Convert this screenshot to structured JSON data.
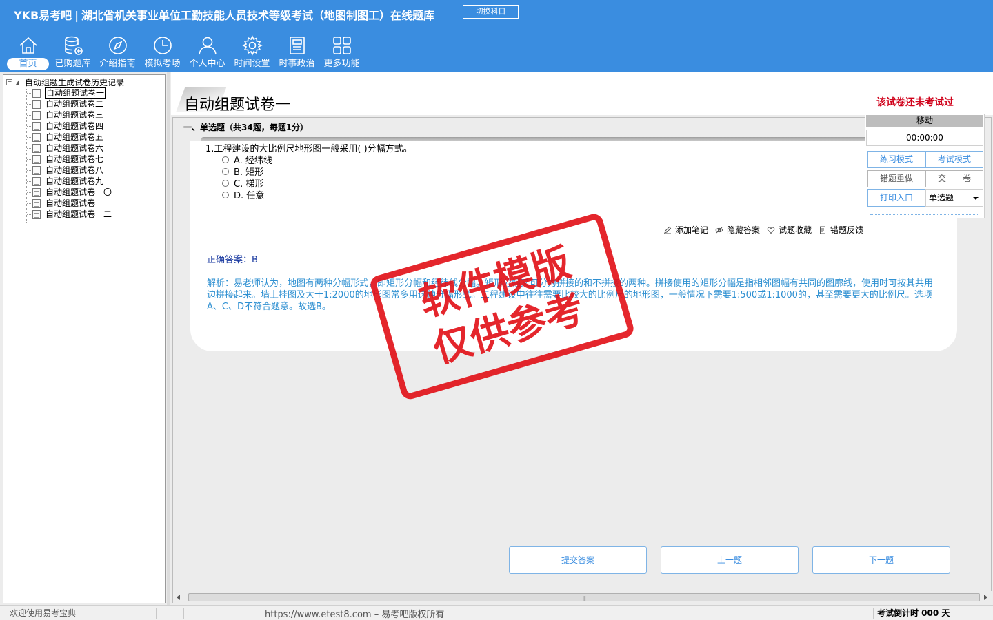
{
  "header": {
    "brand": "YKB易考吧",
    "exam_title": "湖北省机关事业单位工勤技能人员技术等级考试（地图制图工）在线题库",
    "switch_subject": "切换科目"
  },
  "nav": [
    {
      "label": "首页",
      "icon": "home-icon",
      "active": true
    },
    {
      "label": "已购题库",
      "icon": "database-icon"
    },
    {
      "label": "介绍指南",
      "icon": "compass-icon"
    },
    {
      "label": "模拟考场",
      "icon": "clock-icon"
    },
    {
      "label": "个人中心",
      "icon": "user-icon"
    },
    {
      "label": "时间设置",
      "icon": "gear-icon"
    },
    {
      "label": "时事政治",
      "icon": "newspaper-icon"
    },
    {
      "label": "更多功能",
      "icon": "grid-icon"
    }
  ],
  "tree": {
    "root": "自动组题生成试卷历史记录",
    "items": [
      "自动组题试卷一",
      "自动组题试卷二",
      "自动组题试卷三",
      "自动组题试卷四",
      "自动组题试卷五",
      "自动组题试卷六",
      "自动组题试卷七",
      "自动组题试卷八",
      "自动组题试卷九",
      "自动组题试卷一〇",
      "自动组题试卷一一",
      "自动组题试卷一二"
    ],
    "selected_index": 0
  },
  "paper": {
    "title": "自动组题试卷一",
    "status": "该试卷还未考试过",
    "section": "一、单选题（共34题，每题1分）"
  },
  "question": {
    "text": "1.工程建设的大比例尺地形图一般采用( )分幅方式。",
    "options": [
      "A. 经纬线",
      "B. 矩形",
      "C. 梯形",
      "D. 任意"
    ],
    "actions": [
      "添加笔记",
      "隐藏答案",
      "试题收藏",
      "错题反馈"
    ],
    "answer": "正确答案：B",
    "analysis": "解析：易老师认为，地图有两种分幅形式，即矩形分幅和经纬线分幅。矩形分幅又可分为拼接的和不拼接的两种。拼接使用的矩形分幅是指相邻图幅有共同的图廓线，使用时可按其共用边拼接起来。墙上挂图及大于1:2000的地形图常多用这种分幅形式。工程建设中往往需要比较大的比例尺的地形图，一般情况下需要1:500或1:1000的，甚至需要更大的比例尺。选项A、C、D不符合题意。故选B。"
  },
  "watermark": {
    "line1": "软件模版",
    "line2": "仅供参考"
  },
  "mini": {
    "title": "移动",
    "timer": "00:00:00",
    "practice": "练习模式",
    "exam": "考试模式",
    "redo": "错题重做",
    "submit": "交　　卷",
    "print": "打印入口",
    "type_select": "单选题"
  },
  "bottom": {
    "submit_answer": "提交答案",
    "prev": "上一题",
    "next": "下一题"
  },
  "statusbar": {
    "welcome": "欢迎使用易考宝典",
    "copyright": "https://www.etest8.com – 易考吧版权所有",
    "countdown": "考试倒计时 000 天"
  },
  "colors": {
    "header_bg": "#3a8de0",
    "status_red": "#d0021b",
    "answer_blue": "#1a3aa0",
    "analysis_blue": "#2d8fd1",
    "stamp_red": "#e20f16"
  }
}
